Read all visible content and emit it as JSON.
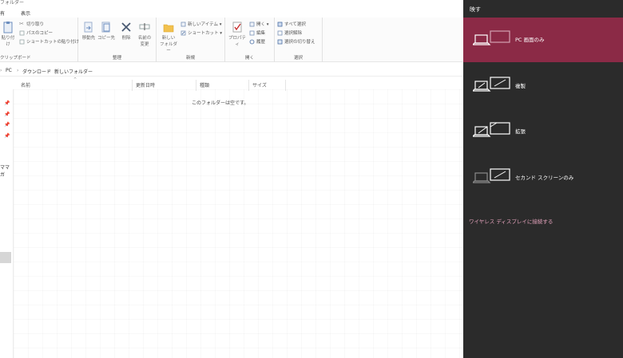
{
  "window_title": "フォルダー",
  "ribbon_tabs": [
    "有",
    "表示"
  ],
  "clipboard": {
    "paste_label": "貼り付け",
    "cut": "切り取り",
    "copy_path": "パスのコピー",
    "paste_shortcut": "ショートカットの貼り付け",
    "group_label": "クリップボード"
  },
  "organize": {
    "move_to": "移動先",
    "copy_to": "コピー先",
    "delete": "削除",
    "rename_1": "名前の",
    "rename_2": "変更",
    "group_label": "整理"
  },
  "new": {
    "new_folder_1": "新しい",
    "new_folder_2": "フォルダー",
    "new_item": "新しいアイテム ▾",
    "shortcut": "ショートカット ▾",
    "group_label": "新規"
  },
  "open": {
    "properties": "プロパティ",
    "open": "開く ▾",
    "edit": "編集",
    "history": "履歴",
    "group_label": "開く"
  },
  "select": {
    "select_all": "すべて選択",
    "select_none": "選択解除",
    "invert": "選択の切り替え",
    "group_label": "選択"
  },
  "address": {
    "crumbs": [
      "PC",
      "ダウンロード",
      "新しいフォルダー"
    ],
    "sep": "›"
  },
  "columns": [
    "名前",
    "更新日時",
    "種類",
    "サイズ"
  ],
  "empty_message": "このフォルダーは空です。",
  "nav_text": "ママガ",
  "project_panel": {
    "title": "映す",
    "options": [
      {
        "label": "PC 画面のみ",
        "selected": true
      },
      {
        "label": "複製",
        "selected": false
      },
      {
        "label": "拡張",
        "selected": false
      },
      {
        "label": "セカンド スクリーンのみ",
        "selected": false
      }
    ],
    "wireless": "ワイヤレス ディスプレイに接続する",
    "selected_color": "#8b2a46",
    "panel_color": "#2b2b2b",
    "link_color": "#e7a4be"
  }
}
